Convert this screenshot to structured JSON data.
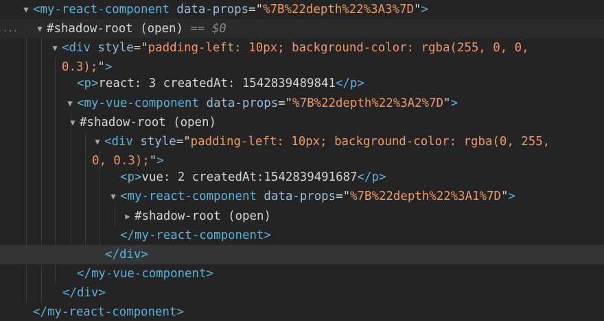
{
  "panel": "elements-tree",
  "colors": {
    "background": "#242424",
    "highlight_row": "#343537",
    "tag": "#5db0d7",
    "attribute_name": "#9bbbdc",
    "attribute_value": "#f29766",
    "text": "#d5d5d5",
    "muted": "#8a8a8a"
  },
  "selection_marker": "...",
  "rows": [
    {
      "caret": "expanded",
      "parts": [
        {
          "t": "tag",
          "s": "<my-react-component"
        },
        {
          "t": "attr",
          "s": " data-props"
        },
        {
          "t": "pun",
          "s": "=\""
        },
        {
          "t": "val",
          "s": "%7B%22depth%22%3A3%7D"
        },
        {
          "t": "pun",
          "s": "\""
        },
        {
          "t": "tag",
          "s": ">"
        }
      ]
    },
    {
      "caret": "expanded",
      "parts": [
        {
          "t": "txt",
          "s": "#shadow-root (open)"
        },
        {
          "t": "cmt",
          "s": " == "
        },
        {
          "t": "var",
          "s": "$0"
        }
      ]
    },
    {
      "caret": "expanded",
      "parts": [
        {
          "t": "tag",
          "s": "<div"
        },
        {
          "t": "attr",
          "s": " style"
        },
        {
          "t": "pun",
          "s": "=\""
        },
        {
          "t": "val",
          "s": "padding-left: 10px; background-color: rgba(255, 0, 0,"
        }
      ]
    },
    {
      "caret": "none",
      "parts": [
        {
          "t": "val",
          "s": "0.3);"
        },
        {
          "t": "pun",
          "s": "\""
        },
        {
          "t": "tag",
          "s": ">"
        }
      ]
    },
    {
      "caret": "none",
      "parts": [
        {
          "t": "tag",
          "s": "<p>"
        },
        {
          "t": "txt",
          "s": "react: 3 createdAt: 1542839489841"
        },
        {
          "t": "tag",
          "s": "</p>"
        }
      ]
    },
    {
      "caret": "expanded",
      "parts": [
        {
          "t": "tag",
          "s": "<my-vue-component"
        },
        {
          "t": "attr",
          "s": " data-props"
        },
        {
          "t": "pun",
          "s": "=\""
        },
        {
          "t": "val",
          "s": "%7B%22depth%22%3A2%7D"
        },
        {
          "t": "pun",
          "s": "\""
        },
        {
          "t": "tag",
          "s": ">"
        }
      ]
    },
    {
      "caret": "expanded",
      "parts": [
        {
          "t": "txt",
          "s": "#shadow-root (open)"
        }
      ]
    },
    {
      "caret": "expanded",
      "parts": [
        {
          "t": "tag",
          "s": "<div"
        },
        {
          "t": "attr",
          "s": " style"
        },
        {
          "t": "pun",
          "s": "=\""
        },
        {
          "t": "val",
          "s": "padding-left: 10px; background-color: rgba(0, 255,"
        }
      ]
    },
    {
      "caret": "none",
      "parts": [
        {
          "t": "val",
          "s": "0, 0.3);"
        },
        {
          "t": "pun",
          "s": "\""
        },
        {
          "t": "tag",
          "s": ">"
        }
      ]
    },
    {
      "caret": "none",
      "parts": [
        {
          "t": "tag",
          "s": "<p>"
        },
        {
          "t": "txt",
          "s": "vue: 2 createdAt:1542839491687"
        },
        {
          "t": "tag",
          "s": "</p>"
        }
      ]
    },
    {
      "caret": "expanded",
      "parts": [
        {
          "t": "tag",
          "s": "<my-react-component"
        },
        {
          "t": "attr",
          "s": " data-props"
        },
        {
          "t": "pun",
          "s": "=\""
        },
        {
          "t": "val",
          "s": "%7B%22depth%22%3A1%7D"
        },
        {
          "t": "pun",
          "s": "\""
        },
        {
          "t": "tag",
          "s": ">"
        }
      ]
    },
    {
      "caret": "collapsed",
      "parts": [
        {
          "t": "txt",
          "s": "#shadow-root (open)"
        }
      ]
    },
    {
      "caret": "none",
      "parts": [
        {
          "t": "tag",
          "s": "</my-react-component>"
        }
      ]
    },
    {
      "caret": "none",
      "parts": [
        {
          "t": "tag",
          "s": "</div>"
        }
      ]
    },
    {
      "caret": "none",
      "parts": [
        {
          "t": "tag",
          "s": "</my-vue-component>"
        }
      ]
    },
    {
      "caret": "none",
      "parts": [
        {
          "t": "tag",
          "s": "</div>"
        }
      ]
    },
    {
      "caret": "none",
      "parts": [
        {
          "t": "tag",
          "s": "</my-react-component>"
        }
      ]
    }
  ]
}
